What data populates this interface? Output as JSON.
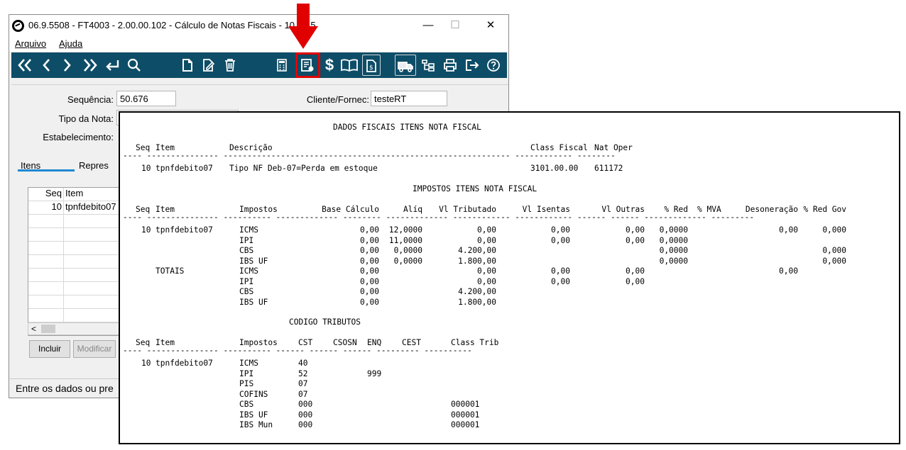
{
  "window": {
    "title": "06.9.5508 - FT4003 - 2.00.00.102 - Cálculo de Notas Fiscais - 10 - 8.5",
    "minimize": "—",
    "maximize": "☐",
    "close": "✕"
  },
  "menu": {
    "file": "Arquivo",
    "help": "Ajuda"
  },
  "toolbar": {
    "icons": [
      "first-icon",
      "prev-icon",
      "next-icon",
      "last-icon",
      "return-icon",
      "search-icon",
      "new-icon",
      "edit-icon",
      "delete-icon",
      "calculator-icon",
      "fiscal-data-icon",
      "price-icon",
      "book-icon",
      "document-icon",
      "truck-icon",
      "tree-icon",
      "print-icon",
      "exit-icon",
      "help-icon"
    ],
    "accent": "#0e4d67",
    "highlight_color": "#e00000"
  },
  "form": {
    "seq_label": "Sequência:",
    "seq_value": "50.676",
    "client_label": "Cliente/Fornec:",
    "client_value": "testeRT",
    "tipo_label": "Tipo da Nota:",
    "estab_label": "Estabelecimento:"
  },
  "tabs": {
    "itens": "Itens",
    "repres": "Repres"
  },
  "grid": {
    "headers": {
      "seq": "Seq",
      "item": "Item"
    },
    "rows": [
      {
        "seq": "10",
        "item": "tpnfdebito07"
      }
    ]
  },
  "buttons": {
    "incluir": "Incluir",
    "modificar": "Modificar"
  },
  "status": "Entre os dados ou pre",
  "report": {
    "section1": {
      "title": "DADOS FISCAIS ITENS NOTA FISCAL",
      "headers": {
        "seq": "Seq",
        "item": "Item",
        "descricao": "Descrição",
        "class_fiscal": "Class Fiscal",
        "nat_oper": "Nat Oper"
      },
      "row": {
        "seq": "10",
        "item": "tpnfdebito07",
        "descricao": "Tipo NF Deb-07=Perda em estoque",
        "class_fiscal": "3101.00.00",
        "nat_oper": "611172"
      }
    },
    "section2": {
      "title": "IMPOSTOS ITENS NOTA FISCAL",
      "headers": {
        "seq": "Seq",
        "item": "Item",
        "impostos": "Impostos",
        "base": "Base Cálculo",
        "aliq": "Alíq",
        "tributado": "Vl Tributado",
        "isentas": "Vl Isentas",
        "outras": "Vl Outras",
        "red": "% Red",
        "mva": "% MVA",
        "desoneracao": "Desoneração",
        "red_gov": "% Red Gov"
      },
      "item_seq": "10",
      "item_name": "tpnfdebito07",
      "rows": [
        {
          "imposto": "ICMS",
          "base": "0,00",
          "aliq": "12,0000",
          "tributado": "0,00",
          "isentas": "0,00",
          "outras": "0,00",
          "red": "0,0000",
          "desoneracao": "0,00",
          "red_gov": "0,000"
        },
        {
          "imposto": "IPI",
          "base": "0,00",
          "aliq": "11,0000",
          "tributado": "0,00",
          "isentas": "0,00",
          "outras": "0,00",
          "red": "0,0000",
          "desoneracao": "",
          "red_gov": ""
        },
        {
          "imposto": "CBS",
          "base": "0,00",
          "aliq": "0,0000",
          "tributado": "4.200,00",
          "isentas": "",
          "outras": "",
          "red": "0,0000",
          "desoneracao": "",
          "red_gov": "0,000"
        },
        {
          "imposto": "IBS UF",
          "base": "0,00",
          "aliq": "0,0000",
          "tributado": "1.800,00",
          "isentas": "",
          "outras": "",
          "red": "0,0000",
          "desoneracao": "",
          "red_gov": "0,000"
        }
      ],
      "totals_label": "TOTAIS",
      "totals": [
        {
          "imposto": "ICMS",
          "base": "0,00",
          "tributado": "0,00",
          "isentas": "0,00",
          "outras": "0,00",
          "desoneracao": "0,00"
        },
        {
          "imposto": "IPI",
          "base": "0,00",
          "tributado": "0,00",
          "isentas": "0,00",
          "outras": "0,00",
          "desoneracao": ""
        },
        {
          "imposto": "CBS",
          "base": "0,00",
          "tributado": "4.200,00",
          "isentas": "",
          "outras": "",
          "desoneracao": ""
        },
        {
          "imposto": "IBS UF",
          "base": "0,00",
          "tributado": "1.800,00",
          "isentas": "",
          "outras": "",
          "desoneracao": ""
        }
      ]
    },
    "section3": {
      "title": "CODIGO TRIBUTOS",
      "headers": {
        "seq": "Seq",
        "item": "Item",
        "impostos": "Impostos",
        "cst": "CST",
        "csosn": "CSOSN",
        "enq": "ENQ",
        "cest": "CEST",
        "class_trib": "Class Trib"
      },
      "item_seq": "10",
      "item_name": "tpnfdebito07",
      "rows": [
        {
          "imposto": "ICMS",
          "cst": "40",
          "enq": "",
          "class_trib": ""
        },
        {
          "imposto": "IPI",
          "cst": "52",
          "enq": "999",
          "class_trib": ""
        },
        {
          "imposto": "PIS",
          "cst": "07",
          "enq": "",
          "class_trib": ""
        },
        {
          "imposto": "COFINS",
          "cst": "07",
          "enq": "",
          "class_trib": ""
        },
        {
          "imposto": "CBS",
          "cst": "000",
          "enq": "",
          "class_trib": "000001"
        },
        {
          "imposto": "IBS UF",
          "cst": "000",
          "enq": "",
          "class_trib": "000001"
        },
        {
          "imposto": "IBS Mun",
          "cst": "000",
          "enq": "",
          "class_trib": "000001"
        }
      ]
    }
  }
}
